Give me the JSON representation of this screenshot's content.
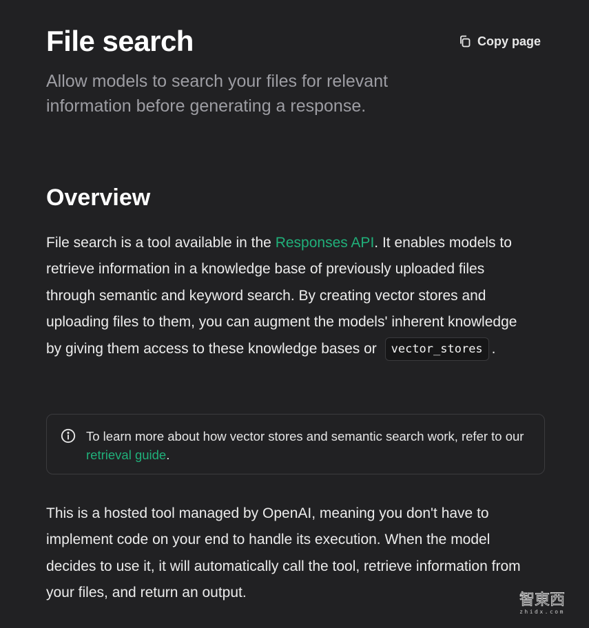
{
  "header": {
    "title": "File search",
    "copy_label": "Copy page",
    "subtitle": "Allow models to search your files for relevant information before generating a response."
  },
  "overview": {
    "heading": "Overview",
    "para1": {
      "before_link": "File search is a tool available in the ",
      "link_text": "Responses API",
      "after_link": ". It enables models to retrieve information in a knowledge base of previously uploaded files through semantic and keyword search. By creating vector stores and uploading files to them, you can augment the models' inherent knowledge by giving them access to these knowledge bases or ",
      "code": "vector_stores",
      "end": "."
    },
    "callout": {
      "before_link": "To learn more about how vector stores and semantic search work, refer to our ",
      "link_text": "retrieval guide",
      "end": "."
    },
    "para2": "This is a hosted tool managed by OpenAI, meaning you don't have to implement code on your end to handle its execution. When the model decides to use it, it will automatically call the tool, retrieve information from your files, and return an output."
  },
  "watermark": {
    "main": "智東西",
    "sub": "zhidx.com"
  },
  "colors": {
    "background": "#212123",
    "link": "#20b07a",
    "subtitle": "#9d9da3"
  },
  "icons": {
    "copy": "copy-icon",
    "info": "info-icon"
  }
}
